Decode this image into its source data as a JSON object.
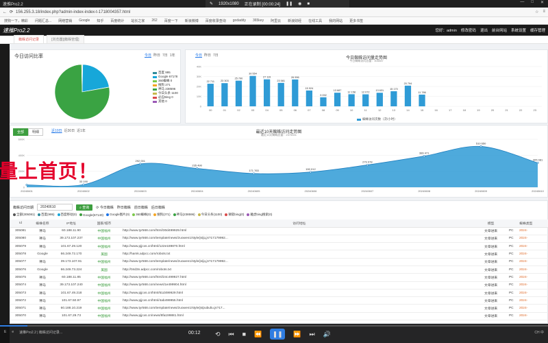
{
  "recorder": {
    "title": "速推Pro2.2",
    "resolution": "1920x1080",
    "status": "正在录制 [00:00:24]"
  },
  "browser": {
    "url": "156.255.3.18/index.php?admin-index-index-t-1718004357.html",
    "bookmarks": [
      "搜狗一下，精彩",
      "问题汇总...",
      "网络营销",
      "Google",
      "知乎",
      "百度统计",
      "站长之家",
      "262",
      "百度一下",
      "新浪微博",
      "百度收录查询",
      "godaddy",
      "365key",
      "阿里云",
      "新浪财经",
      "在线工具",
      "我的网站",
      "更多书签"
    ]
  },
  "app": {
    "logo": "速推Pro2.2",
    "greeting": "您好：admin",
    "header_links": [
      "修改密码",
      "退出",
      "前台网站",
      "系统设置",
      "缓存管理"
    ],
    "tabs": [
      {
        "label": "蜘蛛访问记录",
        "active": true
      },
      {
        "label": "[浏览器][蜘蛛管理]",
        "active": false
      }
    ]
  },
  "pie_panel": {
    "title": "今日访问比率",
    "filters": [
      "今日",
      "昨日",
      "7日",
      "1年"
    ],
    "active_filter": 0
  },
  "bar_panel": {
    "filters": [
      "今日",
      "昨日",
      "7日"
    ],
    "active_filter": 0,
    "legend_label": "蜘蛛访问次数（次/小时）"
  },
  "area_panel": {
    "tabs": [
      "全部",
      "明细"
    ],
    "active_tab": 0,
    "filters": [
      "近10日",
      "近30日",
      "近1年"
    ],
    "active_filter": 0
  },
  "chart_data": [
    {
      "type": "pie",
      "title": "今日访问比率",
      "slices": [
        {
          "name": "百度",
          "value": 995,
          "label": "百度 995",
          "color": "#2e8b9b"
        },
        {
          "name": "Google",
          "value": 67178,
          "label": "Google 67178",
          "color": "#17a7d9"
        },
        {
          "name": "360",
          "value": 0,
          "label": "360蜘蛛 0",
          "color": "#7cc84b"
        },
        {
          "name": "搜狗",
          "value": 271,
          "label": "搜狗 271",
          "color": "#f5a623"
        },
        {
          "name": "神马",
          "value": 238596,
          "label": "神马 238596",
          "color": "#3aa343"
        },
        {
          "name": "今日头条",
          "value": 1100,
          "label": "今日头条 1100",
          "color": "#c8b84a"
        },
        {
          "name": "bing",
          "value": 0,
          "label": "必应Bing 0",
          "color": "#d94a4a"
        },
        {
          "name": "其他",
          "value": 0,
          "label": "其他 0",
          "color": "#9b59b6"
        }
      ]
    },
    {
      "type": "bar",
      "title": "今日蜘蛛访问量走势图",
      "subtitle": "今日蜘蛛访问总量：305087",
      "categories": [
        "00",
        "01",
        "02",
        "03",
        "04",
        "05",
        "06",
        "07",
        "08",
        "09",
        "10",
        "11",
        "12",
        "13",
        "14",
        "15",
        "16",
        "17",
        "18",
        "19",
        "20",
        "21",
        "22",
        "23"
      ],
      "values": [
        22711,
        23303,
        25790,
        30554,
        27119,
        23581,
        26996,
        15924,
        9092,
        13687,
        12158,
        12072,
        13631,
        15170,
        20794,
        11786,
        0,
        0,
        0,
        0,
        0,
        0,
        0,
        0
      ],
      "labels": [
        "22 711",
        "23 303",
        "25 790",
        "30 554",
        "27 119",
        "23 581",
        "26 996",
        "15 924",
        "9 092",
        "13 687",
        "12 158",
        "12 072",
        "13 631",
        "15 170",
        "20 794",
        "11 786",
        "",
        "",
        "",
        "",
        "",
        "",
        "",
        ""
      ],
      "ylim": [
        0,
        40000
      ],
      "yticks": [
        "40K",
        "30K",
        "20K",
        "10K",
        "0"
      ],
      "color": "#2f9bd6"
    },
    {
      "type": "area",
      "title": "最近10天蜘蛛访问走势图",
      "subtitle": "最近10天蜘蛛总量：2375531",
      "categories": [
        "20240601",
        "20240602",
        "20240603",
        "20240604",
        "20240605",
        "20240606",
        "20240607",
        "20240608",
        "20240609",
        "20240610"
      ],
      "values": [
        30000,
        33190,
        292001,
        235490,
        171763,
        190012,
        279078,
        389471,
        510650,
        305081
      ],
      "labels": [
        "",
        "33 190",
        "292 001",
        "235 490",
        "171 763",
        "190 012",
        "279 078",
        "389 471",
        "510 650",
        "305 081"
      ],
      "ylim": [
        0,
        600000
      ],
      "yticks": [
        "600K",
        "400K",
        "200K",
        "0"
      ],
      "color": "#2f9bd6"
    }
  ],
  "table_panel": {
    "toolbar": {
      "date_label": "蜘蛛访问日期",
      "date_value": "20240610",
      "query_label": "查询",
      "links": [
        "今日蜘蛛",
        "昨日蜘蛛",
        "前日蜘蛛",
        "后日蜘蛛"
      ]
    },
    "stats": [
      {
        "label": "全部(305081)",
        "color": "#555555"
      },
      {
        "label": "百度(995)",
        "color": "#2e8b9b"
      },
      {
        "label": "百度移动(0)",
        "color": "#17a7d9"
      },
      {
        "label": "Google(67140)",
        "color": "#3d9e3f"
      },
      {
        "label": "Google图片(0)",
        "color": "#1a73e8"
      },
      {
        "label": "360蜘蛛(0)",
        "color": "#7cc84b"
      },
      {
        "label": "搜狗(271)",
        "color": "#f5a623"
      },
      {
        "label": "神马(238596)",
        "color": "#3aa343"
      },
      {
        "label": "今日头条(1100)",
        "color": "#c8b84a"
      },
      {
        "label": "微软bing(0)",
        "color": "#d94a4a"
      },
      {
        "label": "雅虎bing搜索(0)",
        "color": "#9b59b6"
      }
    ],
    "columns": [
      "Id",
      "蜘蛛名称",
      "IP地址",
      "国家/城市",
      "访问地址",
      "模型",
      "蜘蛛类型"
    ],
    "rows": [
      [
        "305081",
        "神马",
        "60.188.11.90",
        "中国福州",
        "http://www.tyr568.com/html/30d499929.html",
        "文章进来",
        "PC",
        "2024-"
      ],
      [
        "305080",
        "神马",
        "39.173.107.237",
        "中国福州",
        "http://www.tyr568.com/template/news/zuowen1/style/js/jq.js?17179992...",
        "文章进来",
        "PC",
        "2024-"
      ],
      [
        "305079",
        "神马",
        "101.67.29.120",
        "中国福州",
        "http://www.pjjcxs.cn/html/122e189870.html",
        "文章进来",
        "PC",
        "2024-"
      ],
      [
        "305078",
        "Google",
        "66.249.72.170",
        "美国",
        "http://hamk.adpcc.com/robots.txt",
        "文章进来",
        "PC",
        "2024-"
      ],
      [
        "305077",
        "神马",
        "39.173.107.91",
        "中国福州",
        "http://www.tyr568.com/template/news/zuowen1/style/js/jq.js?17179992...",
        "文章进来",
        "PC",
        "2024-"
      ],
      [
        "305076",
        "Google",
        "66.249.73.224",
        "美国",
        "http://04d3n.adpcc.com/robots.txt",
        "文章进来",
        "PC",
        "2024-"
      ],
      [
        "305075",
        "神马",
        "60.188.11.85",
        "中国福州",
        "http://www.tyr568.com/html/24c499927.html",
        "文章进来",
        "PC",
        "2024-"
      ],
      [
        "305074",
        "神马",
        "39.173.107.240",
        "中国福州",
        "http://www.tyr568.com/news/1e499904.html",
        "文章进来",
        "PC",
        "2024-"
      ],
      [
        "305073",
        "神马",
        "101.67.49.218",
        "中国福州",
        "http://www.pjjcxs.cn/html/61d499929.html",
        "文章进来",
        "PC",
        "2024-"
      ],
      [
        "305072",
        "神马",
        "101.67.50.97",
        "中国福州",
        "http://www.pjjcxs.cn/html/4ab499955.html",
        "文章进来",
        "PC",
        "2024-"
      ],
      [
        "305071",
        "神马",
        "60.188.10.219",
        "中国福州",
        "http://www.tyr568.com/template/news/zuowen1/style/js/pubuliu.js?17...",
        "文章进来",
        "PC",
        "2024-"
      ],
      [
        "305070",
        "神马",
        "101.67.29.73",
        "中国福州",
        "http://www.pjjcxs.cn/news/8fa199881.html",
        "文章进来",
        "PC",
        "2024-"
      ]
    ]
  },
  "overlay": {
    "big_text": "量上首页！"
  },
  "player": {
    "time": "00:12",
    "progress": 0.05,
    "tasks": [
      "E",
      "e",
      "速推Pro2.2 | 蜘蛛访问记录..."
    ],
    "tray": "CH 中"
  }
}
